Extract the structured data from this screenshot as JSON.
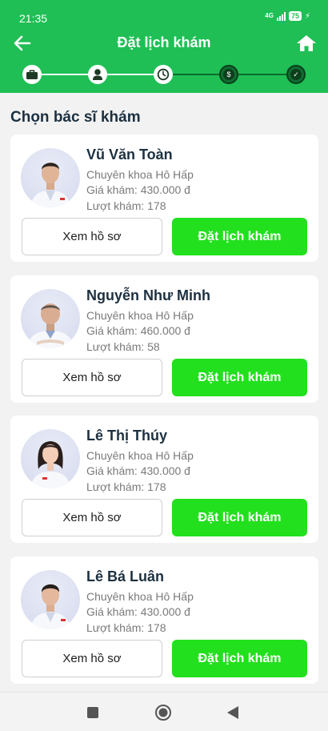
{
  "status_bar": {
    "time": "21:35",
    "network": "4G",
    "battery": "75"
  },
  "header": {
    "title": "Đặt lịch khám",
    "back_icon": "arrow-left-icon",
    "home_icon": "home-icon"
  },
  "stepper": {
    "steps": [
      {
        "icon": "briefcase-icon",
        "active": true
      },
      {
        "icon": "doctor-icon",
        "active": true
      },
      {
        "icon": "clock-icon",
        "active": true
      },
      {
        "icon": "dollar-icon",
        "active": false
      },
      {
        "icon": "check-icon",
        "active": false
      }
    ]
  },
  "section_title": "Chọn bác sĩ khám",
  "doctors": [
    {
      "name": "Vũ Văn Toàn",
      "specialty": "Chuyên khoa Hô Hấp",
      "price": "Giá khám: 430.000 đ",
      "visits": "Lượt khám: 178",
      "profile_label": "Xem hồ sơ",
      "book_label": "Đặt lịch khám"
    },
    {
      "name": "Nguyễn Như Minh",
      "specialty": "Chuyên khoa Hô Hấp",
      "price": "Giá khám: 460.000 đ",
      "visits": "Lượt khám: 58",
      "profile_label": "Xem hồ sơ",
      "book_label": "Đặt lịch khám"
    },
    {
      "name": "Lê Thị Thúy",
      "specialty": "Chuyên khoa Hô Hấp",
      "price": "Giá khám: 430.000 đ",
      "visits": "Lượt khám: 178",
      "profile_label": "Xem hồ sơ",
      "book_label": "Đặt lịch khám"
    },
    {
      "name": "Lê Bá Luân",
      "specialty": "Chuyên khoa Hô Hấp",
      "price": "Giá khám: 430.000 đ",
      "visits": "Lượt khám: 178",
      "profile_label": "Xem hồ sơ",
      "book_label": "Đặt lịch khám"
    }
  ],
  "nav_bar": {
    "recents_icon": "square-icon",
    "home_icon": "circle-icon",
    "back_icon": "triangle-back-icon"
  },
  "colors": {
    "header_green": "#1fbf55",
    "button_green": "#22e01d",
    "text_dark": "#1c3040",
    "text_muted": "#7a7a7a"
  }
}
